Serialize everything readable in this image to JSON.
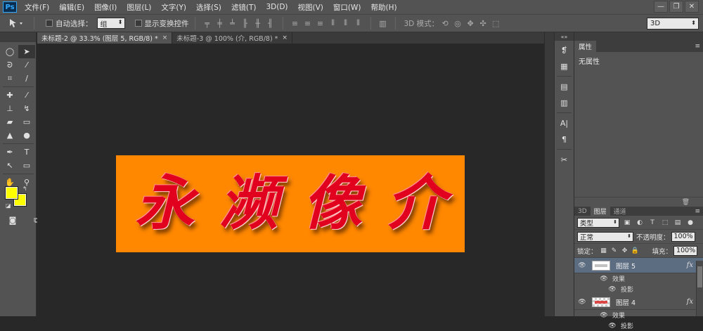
{
  "app": {
    "logo": "Ps"
  },
  "menu": [
    "文件(F)",
    "编辑(E)",
    "图像(I)",
    "图层(L)",
    "文字(Y)",
    "选择(S)",
    "滤镜(T)",
    "3D(D)",
    "视图(V)",
    "窗口(W)",
    "帮助(H)"
  ],
  "window_controls": [
    "—",
    "❐",
    "✕"
  ],
  "options": {
    "auto_select_label": "自动选择：",
    "auto_select_value": "组",
    "show_transform_label": "显示变换控件",
    "mode3d_label": "3D 模式：",
    "workspace": "3D"
  },
  "tabs": [
    {
      "label": "未标题-2 @ 33.3% (图层 5, RGB/8) *",
      "close": "×"
    },
    {
      "label": "未标题-3 @ 100% (介, RGB/8) *",
      "close": "×"
    }
  ],
  "artwork": {
    "background_color": "#ff8800",
    "text_color": "#e2001f",
    "glyphs": [
      "永",
      "濒",
      "像",
      "介"
    ]
  },
  "colors": {
    "foreground": "#ffff00",
    "background": "#ffff00"
  },
  "properties": {
    "tab": "属性",
    "body": "无属性"
  },
  "layers_panel": {
    "tabs": [
      "3D",
      "图层",
      "通道"
    ],
    "filter_value": "类型",
    "blend_mode": "正常",
    "opacity_label": "不透明度：",
    "opacity_value": "100%",
    "lock_label": "锁定：",
    "fill_label": "填充：",
    "fill_value": "100%",
    "layers": [
      {
        "name": "图层 5",
        "fx": "fx",
        "effects_label": "效果",
        "effect": "投影"
      },
      {
        "name": "图层 4",
        "fx": "fx",
        "effects_label": "效果",
        "effect": "投影"
      }
    ]
  }
}
